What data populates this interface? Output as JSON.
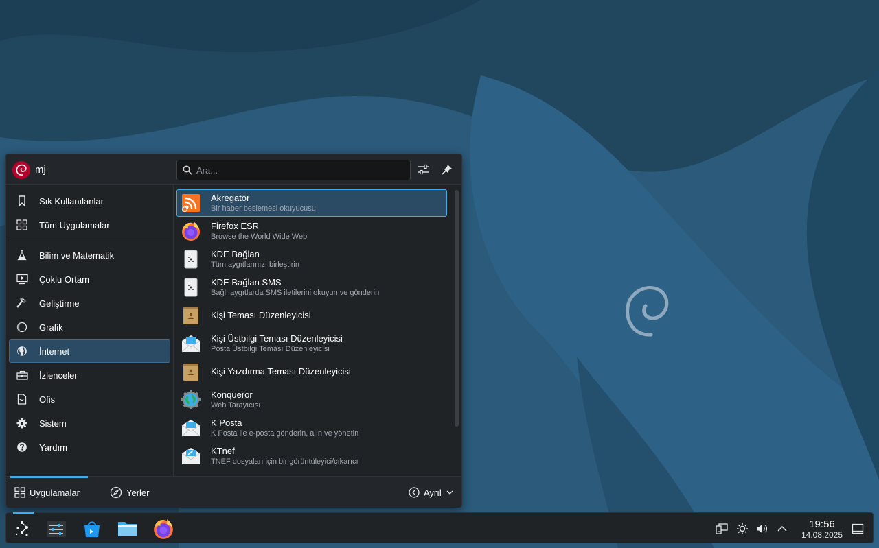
{
  "user": {
    "name": "mj"
  },
  "search": {
    "placeholder": "Ara...",
    "value": ""
  },
  "sidebar": {
    "items": [
      {
        "label": "Sık Kullanılanlar",
        "icon": "bookmark-icon"
      },
      {
        "label": "Tüm Uygulamalar",
        "icon": "grid-icon"
      },
      {
        "label": "Bilim ve Matematik",
        "icon": "flask-icon"
      },
      {
        "label": "Çoklu Ortam",
        "icon": "media-icon"
      },
      {
        "label": "Geliştirme",
        "icon": "hammer-icon"
      },
      {
        "label": "Grafik",
        "icon": "graphics-icon"
      },
      {
        "label": "İnternet",
        "icon": "globe-icon",
        "active": true
      },
      {
        "label": "İzlenceler",
        "icon": "toolbox-icon"
      },
      {
        "label": "Ofis",
        "icon": "document-icon"
      },
      {
        "label": "Sistem",
        "icon": "gear-icon"
      },
      {
        "label": "Yardım",
        "icon": "help-icon"
      }
    ]
  },
  "apps": [
    {
      "name": "Akregatör",
      "desc": "Bir haber beslemesi okuyucusu",
      "icon": "rss-icon",
      "active": true
    },
    {
      "name": "Firefox ESR",
      "desc": "Browse the World Wide Web",
      "icon": "firefox-icon"
    },
    {
      "name": "KDE Bağlan",
      "desc": "Tüm aygıtlarınızı birleştirin",
      "icon": "kdeconnect-icon"
    },
    {
      "name": "KDE Bağlan SMS",
      "desc": "Bağlı aygıtlarda SMS iletilerini okuyun ve gönderin",
      "icon": "kdeconnect-sms-icon"
    },
    {
      "name": "Kişi Teması Düzenleyicisi",
      "desc": "",
      "icon": "contact-theme-icon"
    },
    {
      "name": "Kişi Üstbilgi Teması Düzenleyicisi",
      "desc": "Posta Üstbilgi Teması Düzenleyicisi",
      "icon": "mail-header-icon"
    },
    {
      "name": "Kişi Yazdırma Teması Düzenleyicisi",
      "desc": "",
      "icon": "print-theme-icon"
    },
    {
      "name": "Konqueror",
      "desc": "Web Tarayıcısı",
      "icon": "konqueror-icon"
    },
    {
      "name": "K Posta",
      "desc": "K Posta ile e-posta gönderin, alın ve yönetin",
      "icon": "kmail-icon"
    },
    {
      "name": "KTnef",
      "desc": "TNEF dosyaları için bir görüntüleyici/çıkarıcı",
      "icon": "ktnef-icon"
    }
  ],
  "footer": {
    "apps_tab": "Uygulamalar",
    "places_tab": "Yerler",
    "leave": "Ayrıl"
  },
  "taskbar": {
    "items": [
      "launcher-icon",
      "settings-icon",
      "discover-icon",
      "dolphin-icon",
      "firefox-icon"
    ],
    "tray": [
      "network-icon",
      "brightness-icon",
      "volume-icon",
      "chevron-up-icon"
    ],
    "clock_time": "19:56",
    "clock_date": "14.08.2025"
  },
  "colors": {
    "accent": "#3daee9",
    "panel": "#202326",
    "wallpaper": "#2a5778"
  }
}
